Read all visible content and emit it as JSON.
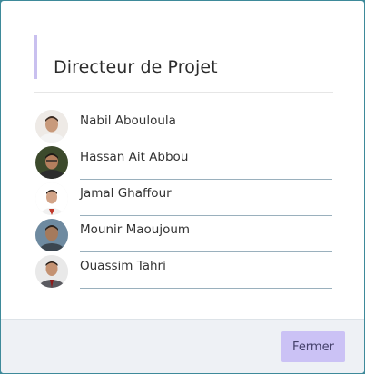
{
  "dialog": {
    "title": "Directeur de Projet",
    "close_label": "Fermer"
  },
  "people": [
    {
      "name": "Nabil Abouloula",
      "avatar": "person-avatar"
    },
    {
      "name": "Hassan Ait Abbou",
      "avatar": "person-avatar"
    },
    {
      "name": "Jamal Ghaffour",
      "avatar": "person-avatar"
    },
    {
      "name": "Mounir Maoujoum",
      "avatar": "person-avatar"
    },
    {
      "name": "Ouassim Tahri",
      "avatar": "person-avatar"
    }
  ],
  "colors": {
    "accent_bar": "#c9c0ef",
    "button_bg": "#cbc2f5",
    "footer_bg": "#eef1f5",
    "backdrop": "#3e8a9a"
  }
}
